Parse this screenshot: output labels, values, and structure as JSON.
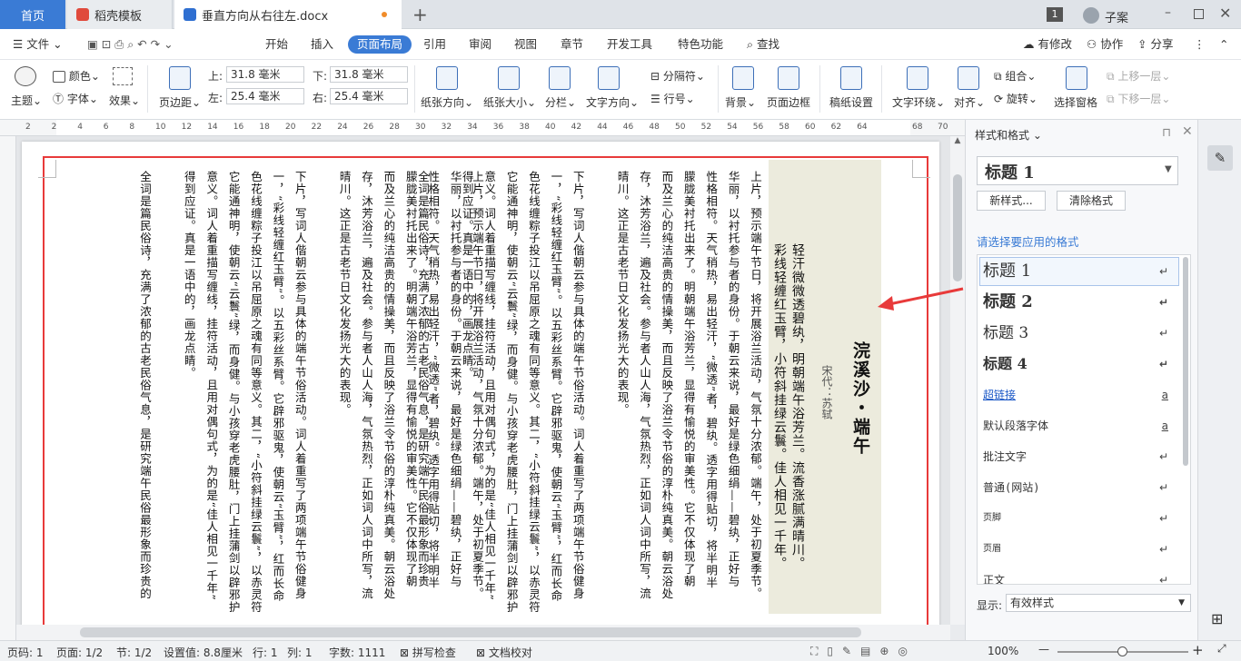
{
  "tabs": {
    "home": "首页",
    "template": "稻壳模板",
    "doc": "垂直方向从右往左.docx",
    "new_tab": "+",
    "badge": "1",
    "user": "子案"
  },
  "menu": {
    "file": "文件",
    "items": [
      "开始",
      "插入",
      "页面布局",
      "引用",
      "审阅",
      "视图",
      "章节",
      "开发工具",
      "特色功能"
    ],
    "active": "页面布局",
    "search": "查找",
    "right": [
      "有修改",
      "协作",
      "分享"
    ]
  },
  "ribbon": {
    "theme": "主题",
    "color": "颜色",
    "font": "字体",
    "effect": "效果",
    "margin": "页边距",
    "top_label": "上:",
    "top_value": "31.8 毫米",
    "bottom_label": "下:",
    "bottom_value": "31.8 毫米",
    "left_label": "左:",
    "left_value": "25.4 毫米",
    "right_label": "右:",
    "right_value": "25.4 毫米",
    "orientation": "纸张方向",
    "size": "纸张大小",
    "columns": "分栏",
    "text_direction": "文字方向",
    "separator": "分隔符",
    "line_no": "行号",
    "background": "背景",
    "page_border": "页面边框",
    "manuscript": "稿纸设置",
    "text_wrap": "文字环绕",
    "align": "对齐",
    "group": "组合",
    "rotate": "旋转",
    "select_pane": "选择窗格",
    "up_layer": "上移一层",
    "down_layer": "下移一层"
  },
  "ruler": {
    "left_marks": [
      "2",
      "2",
      "4",
      "6",
      "8",
      "10",
      "12",
      "14",
      "16",
      "18",
      "20",
      "22",
      "24",
      "26",
      "28",
      "30",
      "32",
      "34",
      "36",
      "38",
      "40",
      "42",
      "44",
      "46",
      "48",
      "50",
      "52",
      "54",
      "56",
      "58",
      "60",
      "62",
      "64"
    ],
    "right_marks": [
      "68",
      "70"
    ]
  },
  "document": {
    "poem_title": "浣溪沙・端午",
    "poem_author": "宋代：苏轼",
    "poem_lines": [
      "轻汗微微透碧纨，明朝端午浴芳兰。流香涨腻满晴川。",
      "彩线轻缠红玉臂，小符斜挂绿云鬟。佳人相见一千年。"
    ],
    "block1": [
      "上片，预示端午节日，将开展浴兰活动，气氛十分浓郁。端午，处于初夏季节。",
      "华丽，以衬托参与者的身份。于朝云来说，最好是绿色细绢——碧纨，正好与",
      "性格相符。天气稍热，易出轻汗，“微透”者，碧纨。透字用得贴切，将半明半",
      "朦胧美衬托出来了。明朝端午浴芳兰，显得有愉悦的审美性。它不仅体现了朝",
      "而及兰心的纯洁高贵的情操美，而且反映了浴兰令节俗的淳朴纯真美。朝云浴处",
      "存，沐芳浴兰，遍及社会。参与者人山人海，气氛热烈，正如词人词中所写，流",
      "晴川。这正是古老节日文化发扬光大的表现。",
      "",
      "下片，写词人偕朝云参与具体的端午节俗活动。词人着重写了两项端午节俗健身",
      "一，“彩线轻缠红玉臂”。以五彩丝系臂。它辟邪驱鬼，使朝云“玉臂”，红而长命",
      "色花线缠粽子投江以吊屈原之魂有同等意义。其二，“小符斜挂绿云鬟”，以赤灵符",
      "它能通神明，使朝云“云鬟”绿，而身健。与小孩穿老虎腰肚，门上挂蒲剑以辟邪护",
      "意义。词人着重描写缠线，挂符活动，且用对偶句式，为的是“佳人相见一千年”",
      "得到应证。真是一语中的，画龙点睛。",
      "",
      "全词是篇民俗诗，充满了浓郁的古老民俗气息，是研究端午民俗最形象而珍贵"
    ],
    "block2": [
      "上片，预示端午节日，将开展浴兰活动，气氛十分浓郁。端午，处于初夏季节。",
      "华丽，以衬托参与者的身份。于朝云来说，最好是绿色细绢——碧纨，正好与",
      "性格相符。天气稍热，易出轻汗，“微透”者，碧纨。透字用得贴切，将半明半",
      "朦胧美衬托出来了。明朝端午浴芳兰，显得有愉悦的审美性。它不仅体现了朝",
      "而及兰心的纯洁高贵的情操美，而且反映了浴兰令节俗的淳朴纯真美。朝云浴处",
      "存，沐芳浴兰，遍及社会。参与者人山人海，气氛热烈，正如词人词中所写，流",
      "晴川。这正是古老节日文化发扬光大的表现。",
      "",
      "下片，写词人偕朝云参与具体的端午节俗活动。词人着重写了两项端午节俗健身",
      "一，“彩线轻缠红玉臂”。以五彩丝系臂。它辟邪驱鬼，使朝云“玉臂”，红而长命",
      "色花线缠粽子投江以吊屈原之魂有同等意义。其二，“小符斜挂绿云鬟”，以赤灵符",
      "它能通神明，使朝云“云鬟”绿，而身健。与小孩穿老虎腰肚，门上挂蒲剑以辟邪护",
      "意义。词人着重描写缠线，挂符活动，且用对偶句式，为的是“佳人相见一千年”",
      "得到应证。真是一语中的，画龙点睛。",
      "",
      "全词是篇民俗诗，充满了浓郁的古老民俗气息，是研究端午民俗最形象而珍贵的"
    ]
  },
  "panel": {
    "title": "样式和格式",
    "current_style": "标题 1",
    "new_style": "新样式...",
    "clear_format": "清除格式",
    "prompt": "请选择要应用的格式",
    "styles": [
      "标题 1",
      "标题 2",
      "标题 3",
      "标题 4",
      "超链接",
      "默认段落字体",
      "批注文字",
      "普通(网站)",
      "页脚",
      "页眉",
      "正文"
    ],
    "show_label": "显示:",
    "show_value": "有效样式"
  },
  "status": {
    "page": "页码: 1",
    "pages": "页面: 1/2",
    "section": "节: 1/2",
    "setting": "设置值: 8.8厘米",
    "row": "行: 1",
    "col": "列: 1",
    "words": "字数: 1111",
    "spell": "拼写检查",
    "proof": "文档校对",
    "zoom": "100%",
    "zoom_level": 0.5
  },
  "colors": {
    "accent": "#3a7bd5",
    "red_box": "#e83a3a",
    "poem_bg": "#ecebdd",
    "link": "#1a57c6"
  }
}
